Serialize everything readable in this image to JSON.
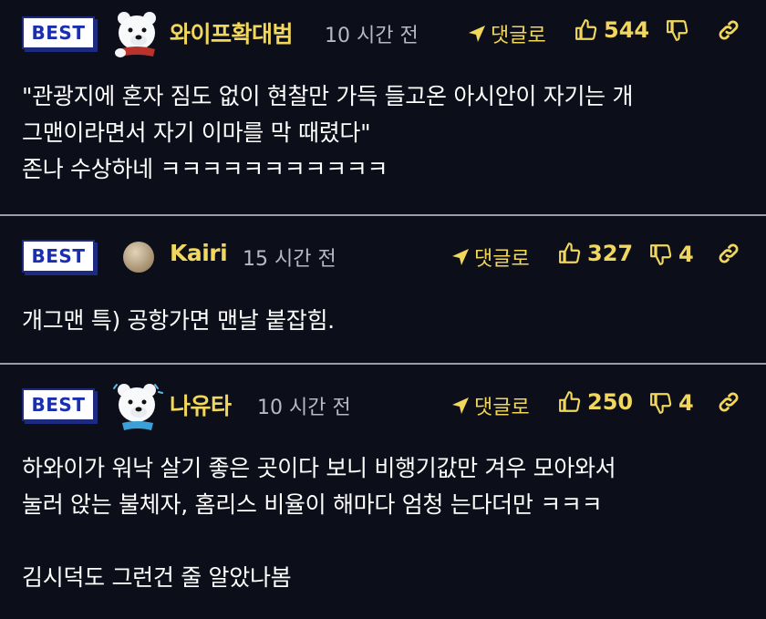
{
  "comments": [
    {
      "badge": "BEST",
      "username": "와이프확대범",
      "time": "10 시간 전",
      "reply": "댓글로",
      "likes": "544",
      "dislikes": "",
      "lines": [
        "\"관광지에 혼자 짐도 없이 현찰만 가득 들고온 아시안이 자기는 개",
        "그맨이라면서 자기 이마를 막 때렸다\"",
        "존나 수상하네 ㅋㅋㅋㅋㅋㅋㅋㅋㅋㅋㅋ"
      ],
      "avatar_icon": "polar-bear-icon"
    },
    {
      "badge": "BEST",
      "username": "Kairi",
      "time": "15 시간 전",
      "reply": "댓글로",
      "likes": "327",
      "dislikes": "4",
      "lines": [
        "개그맨 특) 공항가면 맨날 붙잡힘."
      ],
      "avatar_icon": "beige-circle-avatar"
    },
    {
      "badge": "BEST",
      "username": "나유타",
      "time": "10 시간 전",
      "reply": "댓글로",
      "likes": "250",
      "dislikes": "4",
      "lines": [
        "하와이가 워낙 살기 좋은 곳이다 보니 비행기값만 겨우 모아와서",
        "눌러 앉는 불체자, 홈리스 비율이 해마다 엄청 는다더만 ㅋㅋㅋ",
        "",
        "김시덕도 그런건 줄 알았나봄"
      ],
      "avatar_icon": "polar-bear-icon"
    }
  ],
  "colors": {
    "background": "#0c0f19",
    "accent": "#f1d75d",
    "badge_text": "#1a2fb0",
    "divider": "#9a9da6"
  }
}
